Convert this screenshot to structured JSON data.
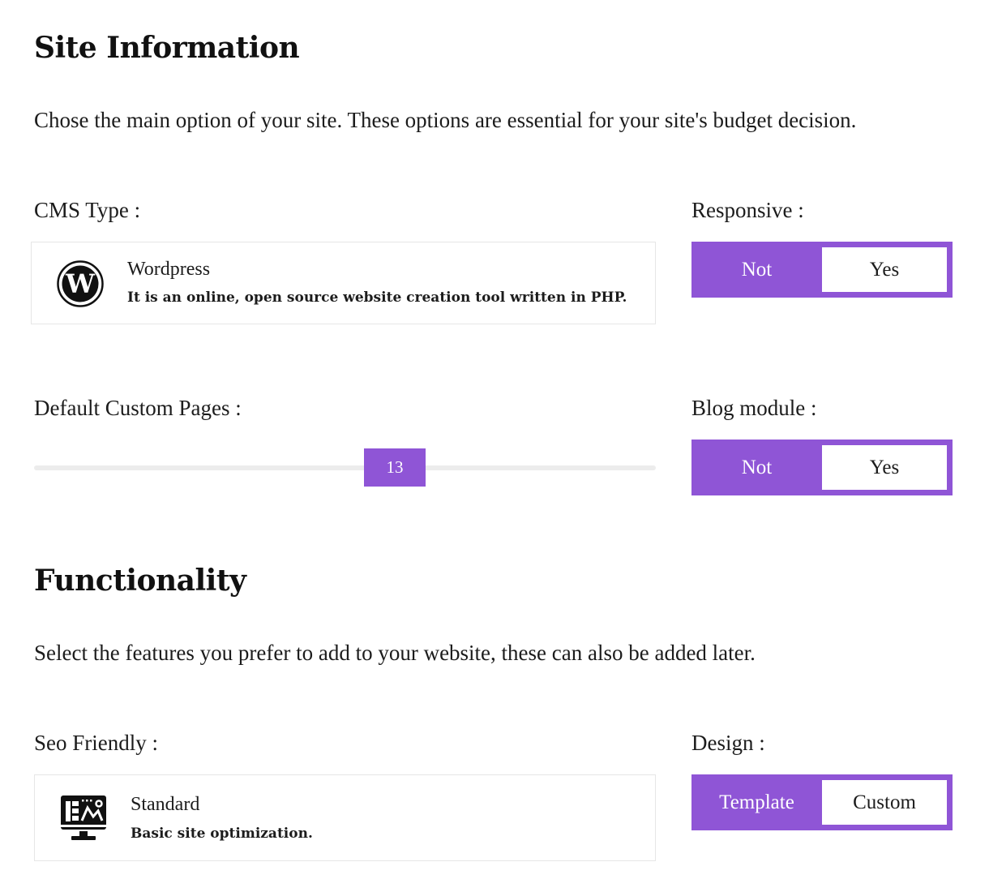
{
  "site_information": {
    "title": "Site Information",
    "description": "Chose the main option of your site. These options are essential for your site's budget decision.",
    "cms_type": {
      "label": "CMS Type :",
      "selected_option": {
        "icon": "wordpress-icon",
        "name": "Wordpress",
        "description": "It is an online, open source website creation tool written in PHP."
      }
    },
    "responsive": {
      "label": "Responsive :",
      "options": [
        "Not",
        "Yes"
      ],
      "selected": "Not"
    },
    "default_custom_pages": {
      "label": "Default Custom Pages :",
      "value": "13",
      "slider_fraction": 0.58
    },
    "blog_module": {
      "label": "Blog module :",
      "options": [
        "Not",
        "Yes"
      ],
      "selected": "Not"
    }
  },
  "functionality": {
    "title": "Functionality",
    "description": "Select the features you prefer to add to your website, these can also be added later.",
    "seo_friendly": {
      "label": "Seo Friendly :",
      "selected_option": {
        "icon": "monitor-dashboard-icon",
        "name": "Standard",
        "description": "Basic site optimization."
      }
    },
    "design": {
      "label": "Design :",
      "options": [
        "Template",
        "Custom"
      ],
      "selected": "Template"
    }
  },
  "colors": {
    "accent": "#8f55d6",
    "text": "#1c1c1c",
    "card_border": "#e6e6e6",
    "track": "#ececec"
  }
}
